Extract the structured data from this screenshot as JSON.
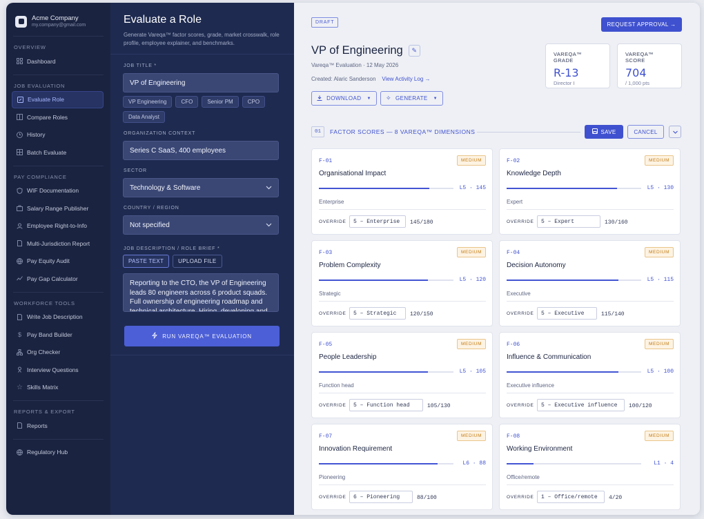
{
  "company": {
    "name": "Acme Company",
    "email": "my.company@gmail.com"
  },
  "sidebar": {
    "sections": [
      {
        "title": "OVERVIEW",
        "items": [
          {
            "label": "Dashboard",
            "icon": "grid-icon"
          }
        ]
      },
      {
        "title": "JOB EVALUATION",
        "items": [
          {
            "label": "Evaluate Role",
            "icon": "edit-icon",
            "active": true
          },
          {
            "label": "Compare Roles",
            "icon": "columns-icon"
          },
          {
            "label": "History",
            "icon": "clock-icon"
          },
          {
            "label": "Batch Evaluate",
            "icon": "grid-icon"
          }
        ]
      },
      {
        "title": "PAY COMPLIANCE",
        "items": [
          {
            "label": "WIF Documentation",
            "icon": "shield-icon"
          },
          {
            "label": "Salary Range Publisher",
            "icon": "briefcase-icon"
          },
          {
            "label": "Employee Right-to-Info",
            "icon": "user-icon"
          },
          {
            "label": "Multi-Jurisdiction Report",
            "icon": "document-icon"
          },
          {
            "label": "Pay Equity Audit",
            "icon": "globe-icon"
          },
          {
            "label": "Pay Gap Calculator",
            "icon": "trend-icon"
          }
        ]
      },
      {
        "title": "WORKFORCE TOOLS",
        "items": [
          {
            "label": "Write Job Description",
            "icon": "document-icon"
          },
          {
            "label": "Pay Band Builder",
            "icon": "dollar-icon"
          },
          {
            "label": "Org Checker",
            "icon": "org-icon"
          },
          {
            "label": "Interview Questions",
            "icon": "person-icon"
          },
          {
            "label": "Skills Matrix",
            "icon": "star-icon"
          }
        ]
      },
      {
        "title": "REPORTS & EXPORT",
        "items": [
          {
            "label": "Reports",
            "icon": "document-icon"
          },
          {
            "label": "Regulatory Hub",
            "icon": "globe-icon"
          }
        ]
      }
    ]
  },
  "form": {
    "title": "Evaluate a Role",
    "subtitle": "Generate Vareqa™ factor scores, grade, market crosswalk, role profile, employee explainer, and benchmarks.",
    "job_title_label": "JOB TITLE *",
    "job_title_value": "VP of Engineering",
    "suggestions": [
      "VP Engineering",
      "CFO",
      "Senior PM",
      "CPO",
      "Data Analyst"
    ],
    "org_label": "ORGANIZATION CONTEXT",
    "org_value": "Series C SaaS, 400 employees",
    "sector_label": "SECTOR",
    "sector_value": "Technology & Software",
    "country_label": "COUNTRY / REGION",
    "country_value": "Not specified",
    "jd_label": "JOB DESCRIPTION / ROLE BRIEF *",
    "paste_label": "PASTE TEXT",
    "upload_label": "UPLOAD FILE",
    "jd_text": "Reporting to the CTO, the VP of Engineering leads 80 engineers across 6 product squads. Full ownership of engineering roadmap and technical architecture. Hiring, developing and",
    "run_label": "RUN VAREQA™ EVALUATION"
  },
  "main": {
    "status": "DRAFT",
    "request_label": "REQUEST APPROVAL →",
    "role_title": "VP of Engineering",
    "evaluation_meta": "Vareqa™ Evaluation · 12 May 2026",
    "created": "Created: Alaric Sanderson",
    "activity_link": "View Activity Log →",
    "download_label": "DOWNLOAD",
    "generate_label": "GENERATE",
    "grade": {
      "label": "VAREQA™ GRADE",
      "value": "R-13",
      "sub": "Director I"
    },
    "score": {
      "label": "VAREQA™ SCORE",
      "value": "704",
      "sub": "/ 1,000 pts"
    },
    "section_num": "01",
    "section_title": "FACTOR SCORES — 8 VAREQA™ DIMENSIONS",
    "save_label": "SAVE",
    "cancel_label": "CANCEL",
    "override_label": "OVERRIDE"
  },
  "factors": [
    {
      "id": "F-01",
      "badge": "MEDIUM",
      "name": "Organisational Impact",
      "level": "L5 · 145",
      "fill": 0.82,
      "category": "Enterprise",
      "override": "5 – Enterprise",
      "score": "145/180"
    },
    {
      "id": "F-02",
      "badge": "MEDIUM",
      "name": "Knowledge Depth",
      "level": "L5 · 130",
      "fill": 0.82,
      "category": "Expert",
      "override": "5 – Expert",
      "score": "130/160"
    },
    {
      "id": "F-03",
      "badge": "MEDIUM",
      "name": "Problem Complexity",
      "level": "L5 · 120",
      "fill": 0.81,
      "category": "Strategic",
      "override": "5 – Strategic",
      "score": "120/150"
    },
    {
      "id": "F-04",
      "badge": "MEDIUM",
      "name": "Decision Autonomy",
      "level": "L5 · 115",
      "fill": 0.83,
      "category": "Executive",
      "override": "5 – Executive",
      "score": "115/140"
    },
    {
      "id": "F-05",
      "badge": "MEDIUM",
      "name": "People Leadership",
      "level": "L5 · 105",
      "fill": 0.81,
      "category": "Function head",
      "override": "5 – Function head",
      "score": "105/130"
    },
    {
      "id": "F-06",
      "badge": "MEDIUM",
      "name": "Influence & Communication",
      "level": "L5 · 100",
      "fill": 0.83,
      "category": "Executive influence",
      "override": "5 – Executive influence",
      "score": "100/120"
    },
    {
      "id": "F-07",
      "badge": "MEDIUM",
      "name": "Innovation Requirement",
      "level": "L6 · 88",
      "fill": 0.88,
      "category": "Pioneering",
      "override": "6 – Pioneering",
      "score": "88/100"
    },
    {
      "id": "F-08",
      "badge": "MEDIUM",
      "name": "Working Environment",
      "level": "L1 · 4",
      "fill": 0.2,
      "category": "Office/remote",
      "override": "1 – Office/remote",
      "score": "4/20"
    }
  ]
}
